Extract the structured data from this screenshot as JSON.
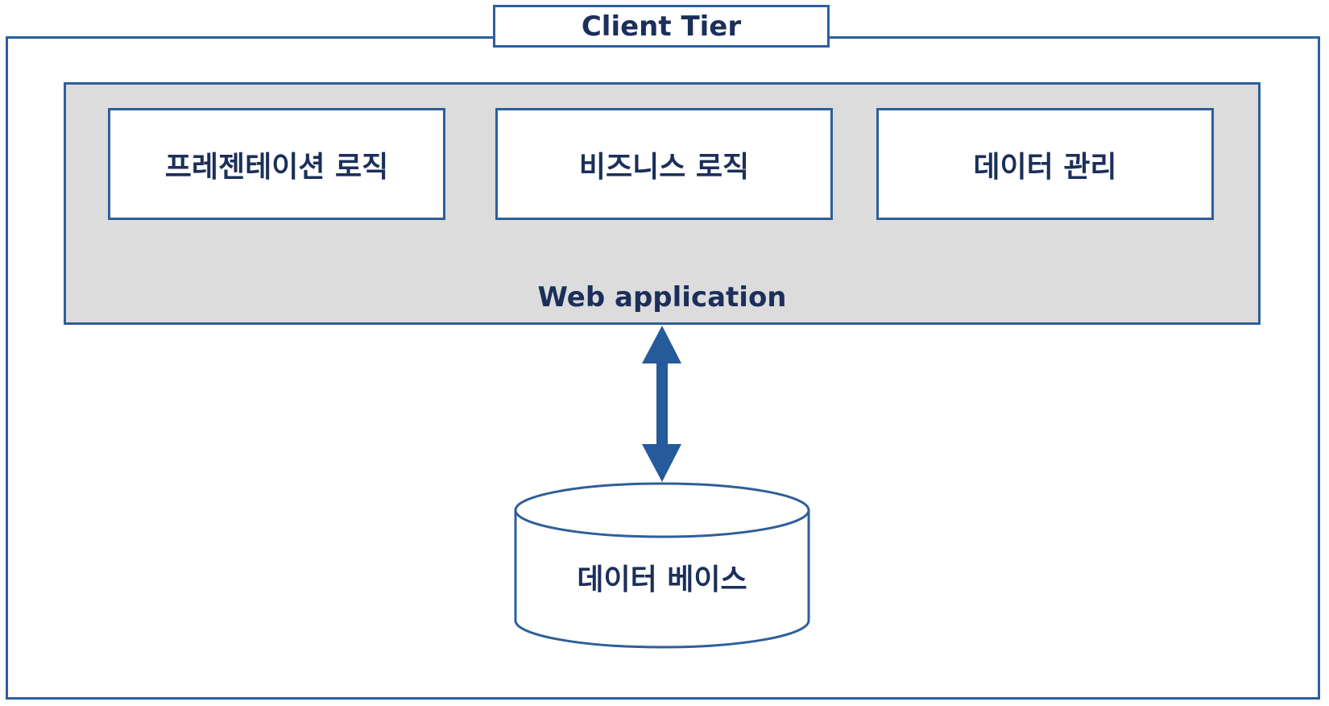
{
  "tier": {
    "title": "Client Tier"
  },
  "web_application": {
    "label": "Web application",
    "modules": [
      {
        "label": "프레젠테이션 로직"
      },
      {
        "label": "비즈니스 로직"
      },
      {
        "label": "데이터 관리"
      }
    ]
  },
  "database": {
    "label": "데이터 베이스"
  },
  "colors": {
    "stroke": "#2d5f99",
    "arrow": "#255a9b",
    "text": "#1c2f5a",
    "webapp_fill": "#dcdcdd"
  }
}
